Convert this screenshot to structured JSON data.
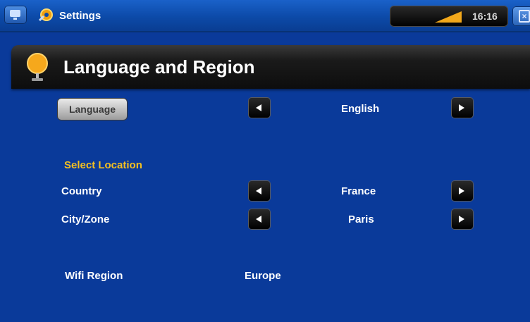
{
  "topbar": {
    "app_title": "Settings",
    "clock": "16:16",
    "icons": [
      "home-icon",
      "settings-icon",
      "signal-icon",
      "close-icon"
    ]
  },
  "banner": {
    "title": "Language and Region",
    "icon": "globe-icon"
  },
  "language": {
    "label": "Language",
    "value": "English"
  },
  "location": {
    "section_title": "Select Location",
    "country_label": "Country",
    "country_value": "France",
    "city_label": "City/Zone",
    "city_value": "Paris"
  },
  "wifi": {
    "label": "Wifi Region",
    "value": "Europe"
  },
  "colors": {
    "background": "#0a3a9a",
    "section_accent": "#f4c020"
  }
}
